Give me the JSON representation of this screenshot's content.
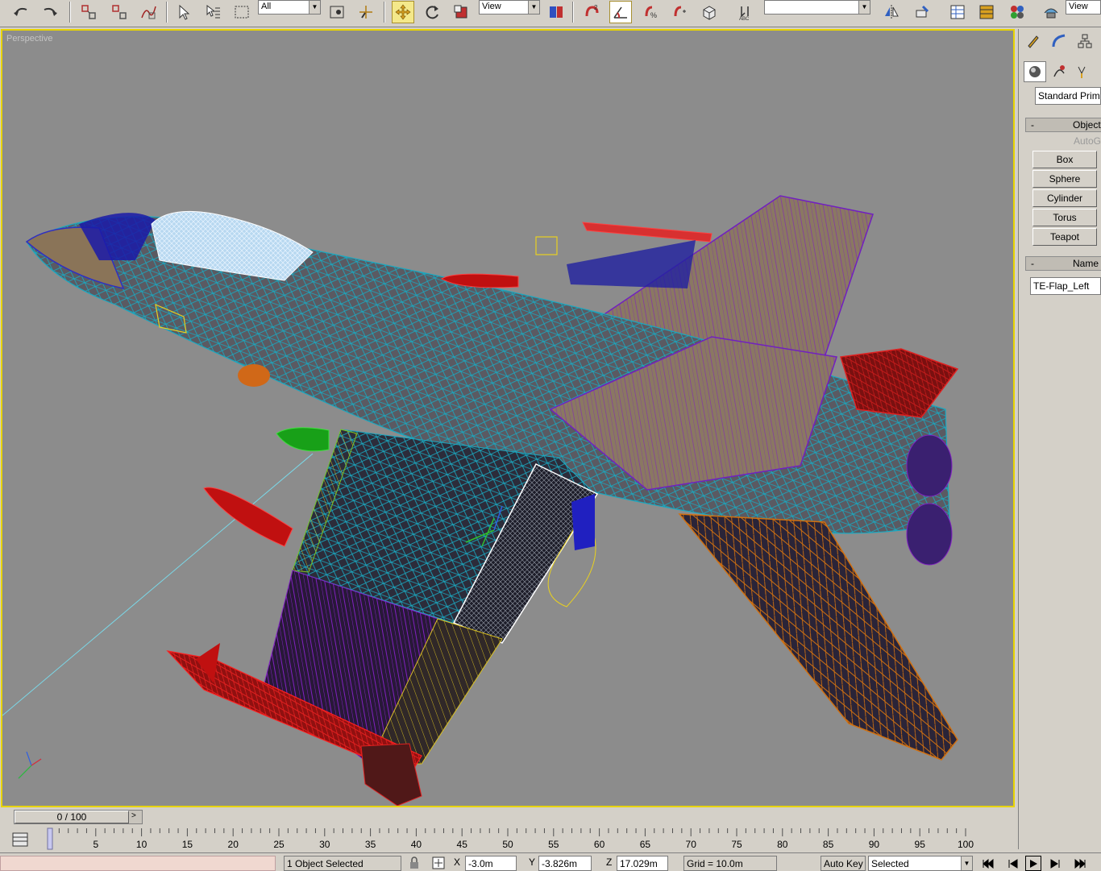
{
  "toolbar": {
    "filter_select": "All",
    "ref_coord_select": "View",
    "pivot_select": "View",
    "named_sel_select": "",
    "icons": [
      "undo-icon",
      "redo-icon",
      "select-link-icon",
      "unlink-icon",
      "bind-space-warp-icon",
      "select-object-icon",
      "select-by-name-icon",
      "rect-region-icon",
      "window-crossing-icon",
      "select-manipulate-icon",
      "move-icon",
      "rotate-icon",
      "scale-icon",
      "pivot-icon",
      "snap-icon",
      "angle-snap-icon",
      "percent-snap-icon",
      "spinner-snap-icon",
      "edit-named-sel-icon",
      "mirror-icon",
      "align-icon",
      "layer-manager-icon",
      "curve-editor-icon",
      "schematic-view-icon",
      "material-editor-icon",
      "render-scene-icon"
    ]
  },
  "viewport": {
    "label": "Perspective",
    "selection_color": "#e8d400",
    "background": "#8c8c8c"
  },
  "command_panel": {
    "tabs": [
      "create-tab",
      "modify-tab",
      "hierarchy-tab"
    ],
    "categories": [
      "geometry-icon",
      "shapes-icon",
      "lights-icon"
    ],
    "type_select": "Standard Primi",
    "object_type_rollout": "Object",
    "autogrid_label": "AutoG",
    "buttons": [
      "Box",
      "Sphere",
      "Cylinder",
      "Torus",
      "Teapot"
    ],
    "name_rollout": "Name a",
    "name_value": "TE-Flap_Left"
  },
  "timeline": {
    "slider_label": "0 / 100",
    "ticks": [
      "5",
      "10",
      "15",
      "20",
      "25",
      "30",
      "35",
      "40",
      "45",
      "50",
      "55",
      "60",
      "65",
      "70",
      "75",
      "80",
      "85",
      "90",
      "95",
      "100"
    ]
  },
  "statusbar": {
    "selection_count": "1 Object Selected",
    "x_label": "X",
    "x_value": "-3.0m",
    "y_label": "Y",
    "y_value": "-3.826m",
    "z_label": "Z",
    "z_value": "17.029m",
    "grid": "Grid = 10.0m",
    "auto_key": "Auto Key",
    "selected_select": "Selected"
  }
}
